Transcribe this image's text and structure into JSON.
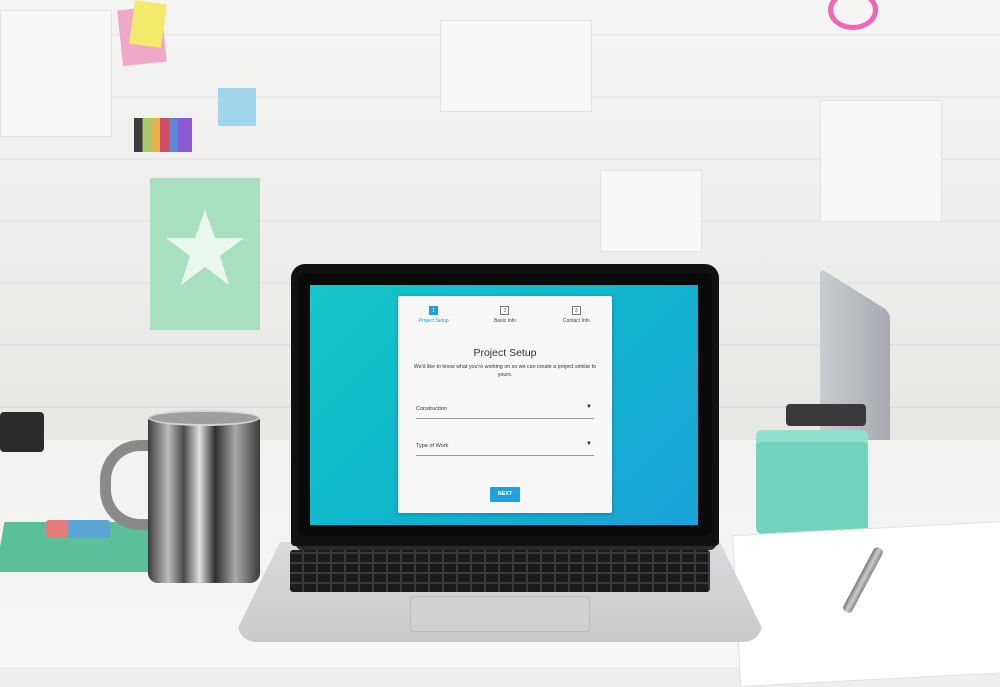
{
  "colors": {
    "accent": "#1ea3e0",
    "screen_gradient_start": "#15c6c9",
    "screen_gradient_end": "#1aa2d8",
    "card_background": "#f7f7f7"
  },
  "stepper": {
    "steps": [
      {
        "number": "1",
        "label": "Project Setup",
        "active": true
      },
      {
        "number": "2",
        "label": "Basic Info",
        "active": false
      },
      {
        "number": "3",
        "label": "Contact Info",
        "active": false
      }
    ]
  },
  "form": {
    "title": "Project Setup",
    "subtitle": "We'd like to know what you're working on so we can create a project similar to yours.",
    "fields": [
      {
        "value": "Construction",
        "icon": "caret-down-icon",
        "caret": "▼"
      },
      {
        "value": "Type of Work",
        "icon": "caret-down-icon",
        "caret": "▼"
      }
    ],
    "next_label": "NEXT"
  }
}
